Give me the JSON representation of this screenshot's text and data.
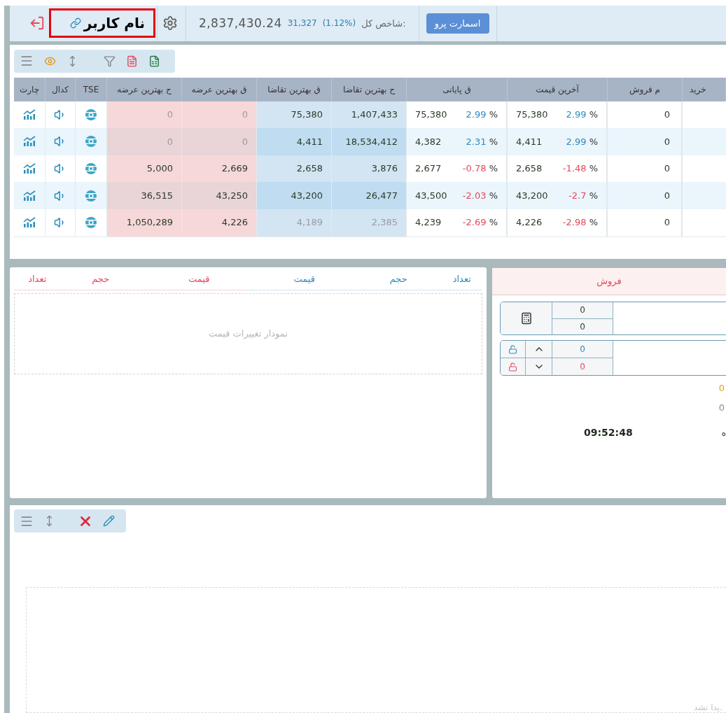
{
  "top_bar": {
    "user_name": "نام کاربر",
    "index_value": "2,837,430.24",
    "index_change": "31,327",
    "index_percent": "(1.12%)",
    "index_label": "شاخص کل:",
    "pro_button": "اسمارت پرو"
  },
  "watchlist": {
    "columns": [
      "خرید",
      "م فروش",
      "آخرین قیمت",
      "ق پایانی",
      "ح بهترین تقاضا",
      "ق بهترین تقاضا",
      "ق بهترین عرضه",
      "ح بهترین عرضه",
      "TSE",
      "کدال",
      "چارت"
    ],
    "rows": [
      {
        "offer_volume": "0",
        "offer_price": "0",
        "offer_dimmed": true,
        "bid_price": "75,380",
        "bid_volume": "1,407,433",
        "bid_dimmed": false,
        "close_price": "75,380",
        "close_change": {
          "value": "2.99",
          "unit": "%",
          "negative": false
        },
        "last_price": "75,380",
        "last_change": {
          "value": "2.99",
          "unit": "%",
          "negative": false
        },
        "sell_count": "0"
      },
      {
        "offer_volume": "0",
        "offer_price": "0",
        "offer_dimmed": true,
        "bid_price": "4,411",
        "bid_volume": "18,534,412",
        "bid_dimmed": false,
        "close_price": "4,382",
        "close_change": {
          "value": "2.31",
          "unit": "%",
          "negative": false
        },
        "last_price": "4,411",
        "last_change": {
          "value": "2.99",
          "unit": "%",
          "negative": false
        },
        "sell_count": "0"
      },
      {
        "offer_volume": "5,000",
        "offer_price": "2,669",
        "offer_dimmed": false,
        "bid_price": "2,658",
        "bid_volume": "3,876",
        "bid_dimmed": false,
        "close_price": "2,677",
        "close_change": {
          "value": "-0.78",
          "unit": "%",
          "negative": true
        },
        "last_price": "2,658",
        "last_change": {
          "value": "-1.48",
          "unit": "%",
          "negative": true
        },
        "sell_count": "0"
      },
      {
        "offer_volume": "36,515",
        "offer_price": "43,250",
        "offer_dimmed": false,
        "bid_price": "43,200",
        "bid_volume": "26,477",
        "bid_dimmed": false,
        "close_price": "43,500",
        "close_change": {
          "value": "-2.03",
          "unit": "%",
          "negative": true
        },
        "last_price": "43,200",
        "last_change": {
          "value": "-2.7",
          "unit": "%",
          "negative": true
        },
        "sell_count": "0"
      },
      {
        "offer_volume": "1,050,289",
        "offer_price": "4,226",
        "offer_dimmed": false,
        "bid_price": "4,189",
        "bid_volume": "2,385",
        "bid_dimmed": true,
        "close_price": "4,239",
        "close_change": {
          "value": "-2.69",
          "unit": "%",
          "negative": true
        },
        "last_price": "4,226",
        "last_change": {
          "value": "-2.98",
          "unit": "%",
          "negative": true
        },
        "sell_count": "0"
      }
    ]
  },
  "order_book": {
    "headers": [
      {
        "label": "تعداد",
        "color": "#2e8bb8"
      },
      {
        "label": "حجم",
        "color": "#2e8bb8"
      },
      {
        "label": "قیمت",
        "color": "#2e8bb8"
      },
      {
        "label": "قیمت",
        "color": "#e5485b"
      },
      {
        "label": "حجم",
        "color": "#e5485b"
      },
      {
        "label": "تعداد",
        "color": "#e5485b"
      }
    ],
    "placeholder": "نمودار تغییرات قیمت"
  },
  "sell_panel": {
    "title": "فروش",
    "calc_values": [
      "0",
      "0"
    ],
    "upper_value": "0",
    "lower_value": "0",
    "value_1": "0",
    "value_2": "0",
    "time": "09:52:48",
    "cut_label": "ه"
  },
  "bottom_panel": {
    "empty_message": "یدا نشد."
  }
}
